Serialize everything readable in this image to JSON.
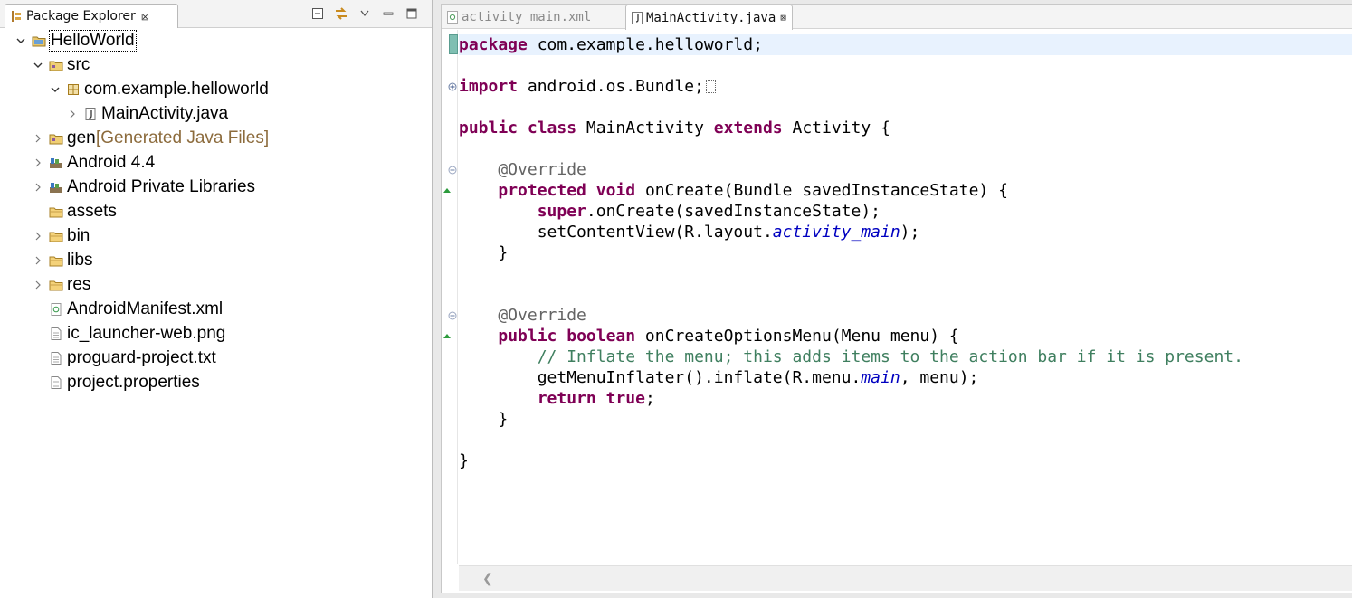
{
  "explorer": {
    "title": "Package Explorer",
    "close_glyph": "⊠",
    "tree": [
      {
        "label": "HelloWorld",
        "decoration": "",
        "icon": "project-icon",
        "depth": 0,
        "expanded": true,
        "selected": true
      },
      {
        "label": "src",
        "decoration": "",
        "icon": "source-folder-icon",
        "depth": 1,
        "expanded": true
      },
      {
        "label": "com.example.helloworld",
        "decoration": "",
        "icon": "package-icon",
        "depth": 2,
        "expanded": true
      },
      {
        "label": "MainActivity.java",
        "decoration": "",
        "icon": "java-file-icon",
        "depth": 3,
        "expanded": false
      },
      {
        "label": "gen",
        "decoration": " [Generated Java Files]",
        "icon": "source-folder-icon",
        "depth": 1,
        "expanded": false
      },
      {
        "label": "Android 4.4",
        "decoration": "",
        "icon": "library-icon",
        "depth": 1,
        "expanded": false
      },
      {
        "label": "Android Private Libraries",
        "decoration": "",
        "icon": "library-icon",
        "depth": 1,
        "expanded": false
      },
      {
        "label": "assets",
        "decoration": "",
        "icon": "folder-icon",
        "depth": 1,
        "leaf": true
      },
      {
        "label": "bin",
        "decoration": "",
        "icon": "folder-icon",
        "depth": 1,
        "expanded": false
      },
      {
        "label": "libs",
        "decoration": "",
        "icon": "folder-icon",
        "depth": 1,
        "expanded": false
      },
      {
        "label": "res",
        "decoration": "",
        "icon": "folder-icon",
        "depth": 1,
        "expanded": false
      },
      {
        "label": "AndroidManifest.xml",
        "decoration": "",
        "icon": "xml-file-icon",
        "depth": 1,
        "leaf": true
      },
      {
        "label": "ic_launcher-web.png",
        "decoration": "",
        "icon": "file-icon",
        "depth": 1,
        "leaf": true
      },
      {
        "label": "proguard-project.txt",
        "decoration": "",
        "icon": "file-icon",
        "depth": 1,
        "leaf": true
      },
      {
        "label": "project.properties",
        "decoration": "",
        "icon": "file-icon",
        "depth": 1,
        "leaf": true
      }
    ]
  },
  "editor": {
    "tabs": [
      {
        "label": "activity_main.xml",
        "active": false
      },
      {
        "label": "MainActivity.java",
        "active": true,
        "close_glyph": "⊠"
      }
    ],
    "code": {
      "package": [
        "package",
        " com.example.helloworld;"
      ],
      "import": [
        "import",
        " android.os.Bundle;"
      ],
      "class_decl": [
        "public",
        " ",
        "class",
        " MainActivity ",
        "extends",
        " Activity {"
      ],
      "override1": "    @Override",
      "oncreate_sig": [
        "    ",
        "protected",
        " ",
        "void",
        " onCreate(Bundle savedInstanceState) {"
      ],
      "super_call": [
        "        ",
        "super",
        ".onCreate(savedInstanceState);"
      ],
      "setcontent": [
        "        setContentView(R.layout.",
        "activity_main",
        ");"
      ],
      "close1": "    }",
      "override2": "    @Override",
      "menu_sig": [
        "    ",
        "public",
        " ",
        "boolean",
        " onCreateOptionsMenu(Menu menu) {"
      ],
      "comment": "        // Inflate the menu; this adds items to the action bar if it is present.",
      "inflate": [
        "        getMenuInflater().inflate(R.menu.",
        "main",
        ", menu);"
      ],
      "return_stmt": [
        "        ",
        "return",
        " ",
        "true",
        ";"
      ],
      "close2": "    }",
      "close_class": "}"
    },
    "colors": {
      "keyword": "#7f0055",
      "annotation": "#646464",
      "comment": "#3f7f5f",
      "field": "#0000c0",
      "current_line": "#e8f2fe"
    }
  }
}
